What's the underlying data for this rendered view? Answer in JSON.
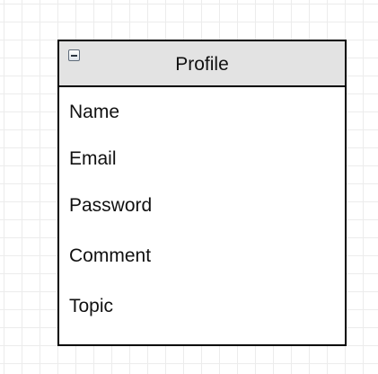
{
  "entity": {
    "title": "Profile",
    "collapse_icon": "minus-square-icon",
    "fields": [
      {
        "label": "Name"
      },
      {
        "label": "Email"
      },
      {
        "label": "Password"
      },
      {
        "label": "Comment"
      },
      {
        "label": "Topic"
      }
    ]
  },
  "colors": {
    "header_fill": "#e3e3e3",
    "border": "#000000",
    "grid": "#ececec",
    "background": "#ffffff"
  }
}
